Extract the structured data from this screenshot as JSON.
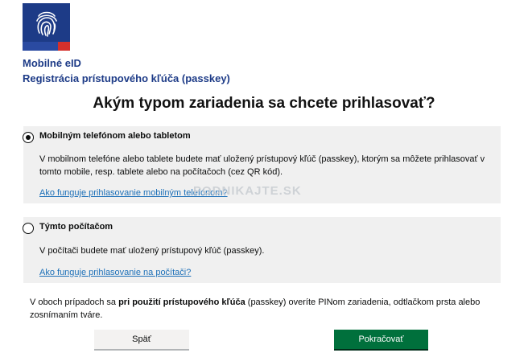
{
  "header": {
    "app_name": "Mobilné eID",
    "subtitle": "Registrácia prístupového kľúča (passkey)"
  },
  "heading": "Akým typom zariadenia sa chcete prihlasovať?",
  "options": [
    {
      "title": "Mobilným telefónom alebo tabletom",
      "selected": true,
      "description": "V mobilnom telefóne alebo tablete budete mať uložený prístupový kľúč (passkey), ktorým sa môžete prihlasovať v tomto mobile, resp. tablete alebo na počítačoch (cez QR kód).",
      "link": "Ako funguje prihlasovanie mobilným telefónom?"
    },
    {
      "title": "Týmto počítačom",
      "selected": false,
      "description": "V počítači budete mať uložený prístupový kľúč (passkey).",
      "link": "Ako funguje prihlasovanie na počítači?"
    }
  ],
  "note": {
    "before": "V oboch prípadoch sa ",
    "bold": "pri použití prístupového kľúča",
    "after": " (passkey) overíte PINom zariadenia, odtlačkom prsta alebo zosnímaním tváre."
  },
  "buttons": {
    "back": "Späť",
    "next": "Pokračovať"
  },
  "watermark": "PODNIKAJTE.SK",
  "colors": {
    "brand_blue": "#1d3b87",
    "link": "#1d70b8",
    "primary_button": "#00703c",
    "option_background": "#f0f0f0"
  }
}
